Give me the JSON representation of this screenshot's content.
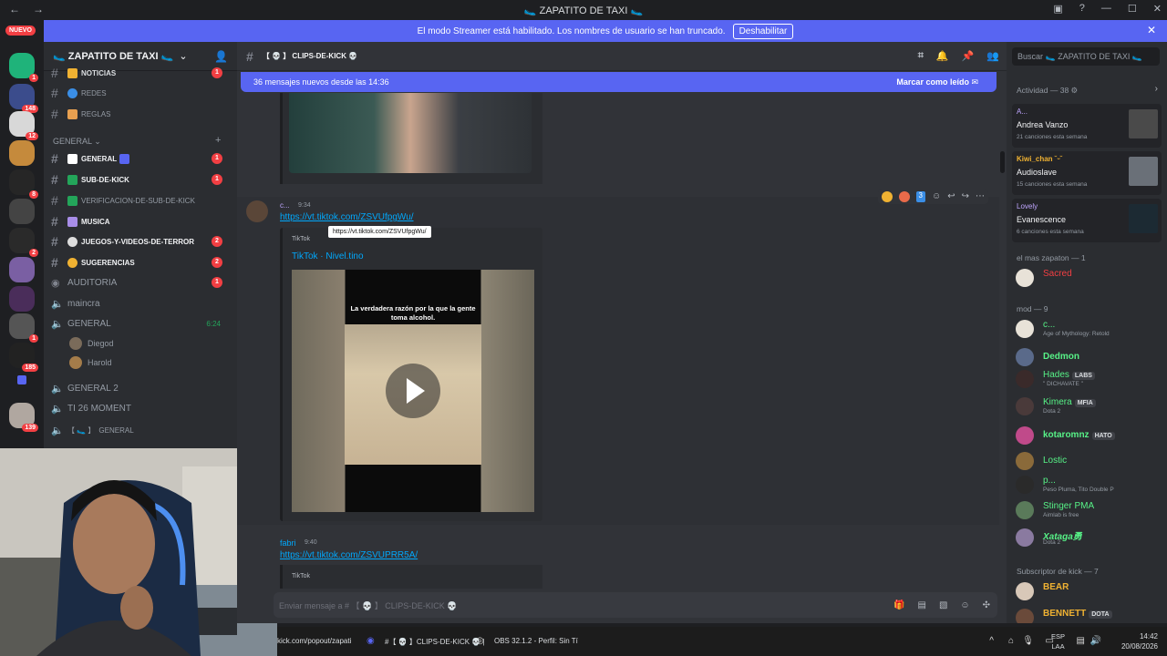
{
  "window": {
    "title": "🥿 ZAPATITO DE TAXI 🥿"
  },
  "banner": {
    "text": "El modo Streamer está habilitado. Los nombres de usuario se han truncado.",
    "button": "Deshabilitar"
  },
  "guilds": {
    "nuevo": "NUEVO",
    "badges": [
      "1",
      "148",
      "12",
      "8",
      "2",
      "1",
      "185",
      "139"
    ]
  },
  "server": {
    "name": "🥿 ZAPATITO DE TAXI 🥿",
    "channels_top": [
      {
        "label": "NOTICIAS",
        "badge": "1"
      },
      {
        "label": "REDES",
        "badge": ""
      },
      {
        "label": "REGLAS",
        "badge": ""
      }
    ],
    "category": "GENERAL",
    "channels": [
      {
        "label": "GENERAL",
        "badge": "1",
        "bold": true
      },
      {
        "label": "SUB-DE-KICK",
        "badge": "1",
        "bold": true
      },
      {
        "label": "VERIFICACION-DE-SUB-DE-KICK",
        "badge": "",
        "bold": false
      },
      {
        "label": "MUSICA",
        "badge": "",
        "bold": true
      },
      {
        "label": "JUEGOS-Y-VIDEOS-DE-TERROR",
        "badge": "2",
        "bold": true
      },
      {
        "label": "SUGERENCIAS",
        "badge": "2",
        "bold": true
      }
    ],
    "voice": [
      {
        "label": "AUDITORIA",
        "badge": "1"
      },
      {
        "label": "maincra"
      },
      {
        "label": "GENERAL",
        "time": "6:24"
      }
    ],
    "voice_users": [
      "Diegod",
      "Harold"
    ],
    "voice_after": [
      "GENERAL 2",
      "TI 26 MOMENT",
      "GENERAL"
    ]
  },
  "chat": {
    "channel": "【 💀 】 CLIPS-DE-KICK 💀",
    "new_messages": "36 mensajes nuevos desde las 14:36",
    "mark_read": "Marcar como leído",
    "msg1": {
      "author": "c...",
      "time": "9:34",
      "link": "https://vt.tiktok.com/ZSVUfpgWu/",
      "tooltip": "https://vt.tiktok.com/ZSVUfpgWu/",
      "provider": "TikTok",
      "embed_title": "TikTok · Nivel.tino",
      "caption": "La verdadera razón por la que la gente toma alcohol."
    },
    "msg2": {
      "author": "fabri",
      "time": "9:40",
      "link": "https://vt.tiktok.com/ZSVUPRR5A/",
      "provider": "TikTok"
    },
    "reaction_count": "3",
    "input_placeholder": "Enviar mensaje a # 【 💀 】 CLIPS-DE-KICK 💀"
  },
  "members": {
    "search_placeholder": "Buscar 🥿 ZAPATITO DE TAXI 🥿",
    "activity_header": "Actividad — 38",
    "activities": [
      {
        "who": "A...",
        "name": "Andrea Vanzo",
        "sub": "21 canciones esta semana"
      },
      {
        "who": "Kiwi_chan ˘ᵕ˘",
        "name": "Audioslave",
        "sub": "15 canciones esta semana"
      },
      {
        "who": "Lovely",
        "name": "Evanescence",
        "sub": "6 canciones esta semana"
      }
    ],
    "group1": "el mas zapaton — 1",
    "group1_members": [
      {
        "name": "Sacred",
        "color": "#f23f43",
        "status": ""
      }
    ],
    "group2": "mod — 9",
    "group2_members": [
      {
        "name": "c...",
        "color": "#57f287",
        "status": "Age of Mythology: Retold",
        "tag": ""
      },
      {
        "name": "Dedmon",
        "color": "#57f287",
        "status": "",
        "tag": ""
      },
      {
        "name": "Hades",
        "color": "#57f287",
        "status": "\" DICHAVATE \"",
        "tag": "LABS"
      },
      {
        "name": "Kimera",
        "color": "#57f287",
        "status": "Dota 2",
        "tag": "MFIA"
      },
      {
        "name": "kotaromnz",
        "color": "#57f287",
        "status": "",
        "tag": "HATO"
      },
      {
        "name": "Lostic",
        "color": "#57f287",
        "status": "",
        "tag": ""
      },
      {
        "name": "p...",
        "color": "#57f287",
        "status": "Peso Pluma, Tito Double P",
        "tag": ""
      },
      {
        "name": "Stinger PMA",
        "color": "#57f287",
        "status": "Aimlab is free",
        "tag": ""
      },
      {
        "name": "Xataga勇",
        "color": "#57f287",
        "status": "Dota 2",
        "tag": ""
      }
    ],
    "group3": "Subscriptor de kick — 7",
    "group3_members": [
      {
        "name": "BEAR",
        "color": "#f0b232",
        "status": "",
        "tag": ""
      },
      {
        "name": "BENNETT",
        "color": "#f0b232",
        "status": "",
        "tag": "DOTA"
      }
    ]
  },
  "taskbar": {
    "browser": "kick.com/popout/zapati",
    "discord": "#【 💀 】CLIPS-DE-KICK 💀 |",
    "obs": "OBS 32.1.2 - Perfil: Sin Tí",
    "lang1": "ESP",
    "lang2": "LAA",
    "time": "14:42",
    "date": "20/08/2026"
  }
}
